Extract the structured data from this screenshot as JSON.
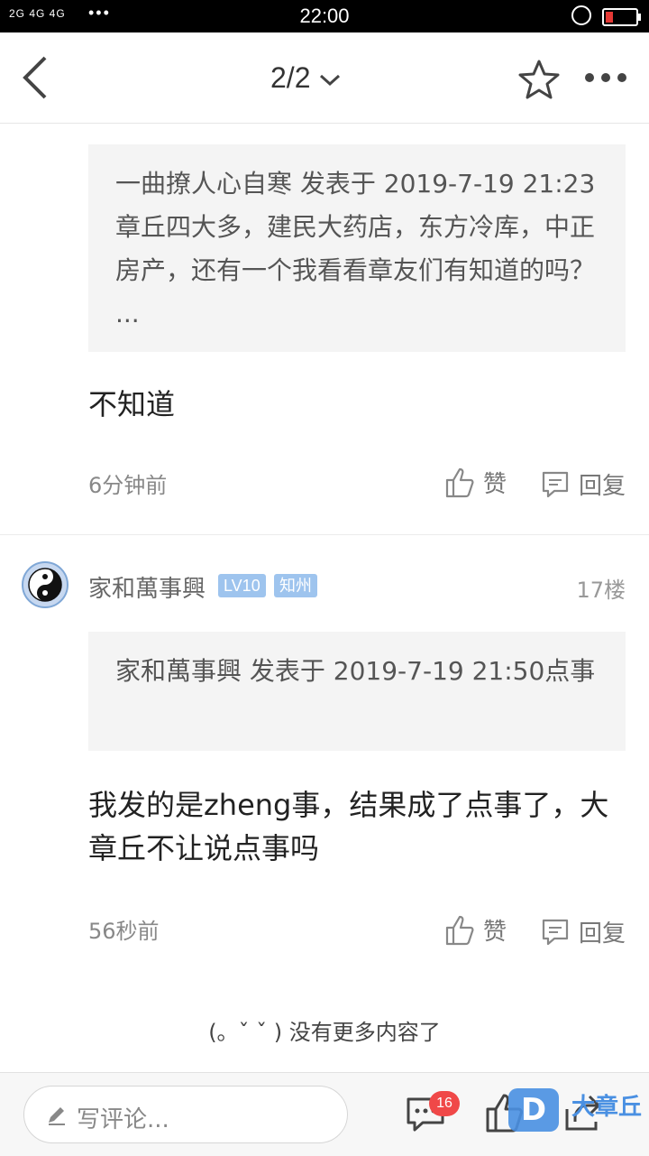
{
  "status": {
    "network": "2G  4G 4G",
    "dots": "•••",
    "time": "22:00"
  },
  "nav": {
    "pager": "2/2"
  },
  "post1": {
    "quote": "一曲撩人心自寒 发表于 2019-7-19 21:23章丘四大多，建民大药店，东方冷库，中正房产，还有一个我看看章友们有知道的吗？ ...",
    "body": "不知道",
    "time": "6分钟前",
    "like_label": "赞",
    "reply_label": "回复"
  },
  "post2": {
    "username": "家和萬事興",
    "level": "LV10",
    "area": "知州",
    "floor": "17楼",
    "quote": "家和萬事興 发表于 2019-7-19 21:50点事",
    "body": "我发的是zheng事，结果成了点事了，大章丘不让说点事吗",
    "time": "56秒前",
    "like_label": "赞",
    "reply_label": "回复"
  },
  "footer_note": "(。ˇ ˇ ) 没有更多内容了",
  "bottom": {
    "comment_placeholder": "写评论...",
    "comment_count": "16",
    "brand": "大章丘",
    "brand_logo": "D"
  }
}
